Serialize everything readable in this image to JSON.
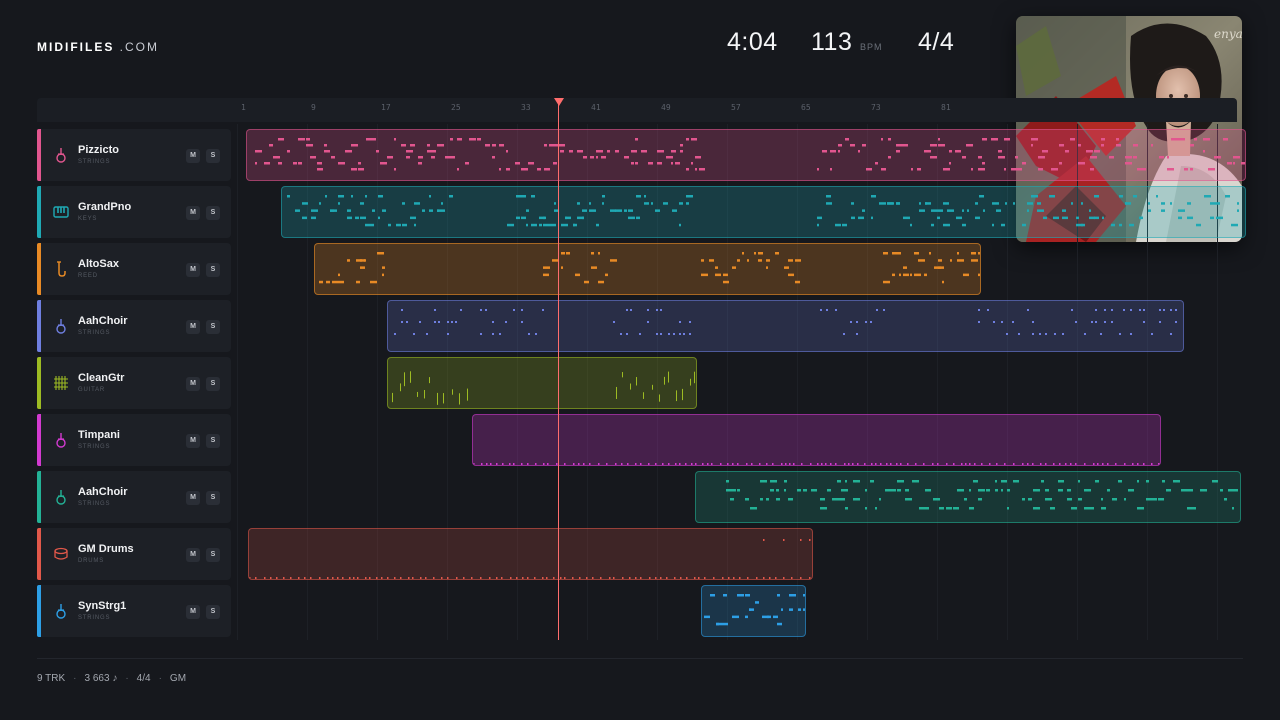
{
  "brand": {
    "name": "MIDIFILES",
    "suffix": " .COM"
  },
  "header": {
    "duration": "4:04",
    "tempo": "113",
    "tempo_unit": "BPM",
    "time_signature": "4/4"
  },
  "album_art": {
    "description_icon": "album-cover-image"
  },
  "ruler": {
    "ticks": [
      "1",
      "9",
      "17",
      "25",
      "33",
      "41",
      "49",
      "57",
      "65",
      "73",
      "81"
    ]
  },
  "tracks": [
    {
      "name": "Pizzicto",
      "category": "STRINGS",
      "color": "#e2568f",
      "icon": "guitar-icon",
      "mute": "M",
      "solo": "S"
    },
    {
      "name": "GrandPno",
      "category": "KEYS",
      "color": "#1fa9b4",
      "icon": "piano-icon",
      "mute": "M",
      "solo": "S"
    },
    {
      "name": "AltoSax",
      "category": "REED",
      "color": "#e88a25",
      "icon": "saxophone-icon",
      "mute": "M",
      "solo": "S"
    },
    {
      "name": "AahChoir",
      "category": "STRINGS",
      "color": "#6f7fe0",
      "icon": "guitar-icon",
      "mute": "M",
      "solo": "S"
    },
    {
      "name": "CleanGtr",
      "category": "GUITAR",
      "color": "#9dbb23",
      "icon": "fretboard-icon",
      "mute": "M",
      "solo": "S"
    },
    {
      "name": "Timpani",
      "category": "STRINGS",
      "color": "#d23ad0",
      "icon": "guitar-icon",
      "mute": "M",
      "solo": "S"
    },
    {
      "name": "AahChoir",
      "category": "STRINGS",
      "color": "#23b296",
      "icon": "guitar-icon",
      "mute": "M",
      "solo": "S"
    },
    {
      "name": "GM Drums",
      "category": "DRUMS",
      "color": "#e2584a",
      "icon": "drum-icon",
      "mute": "M",
      "solo": "S"
    },
    {
      "name": "SynStrg1",
      "category": "STRINGS",
      "color": "#2d9fe6",
      "icon": "guitar-icon",
      "mute": "M",
      "solo": "S"
    }
  ],
  "footer": {
    "tracks": "9 TRK",
    "notes": "3 663 ♪",
    "time_signature": "4/4",
    "format": "GM"
  }
}
